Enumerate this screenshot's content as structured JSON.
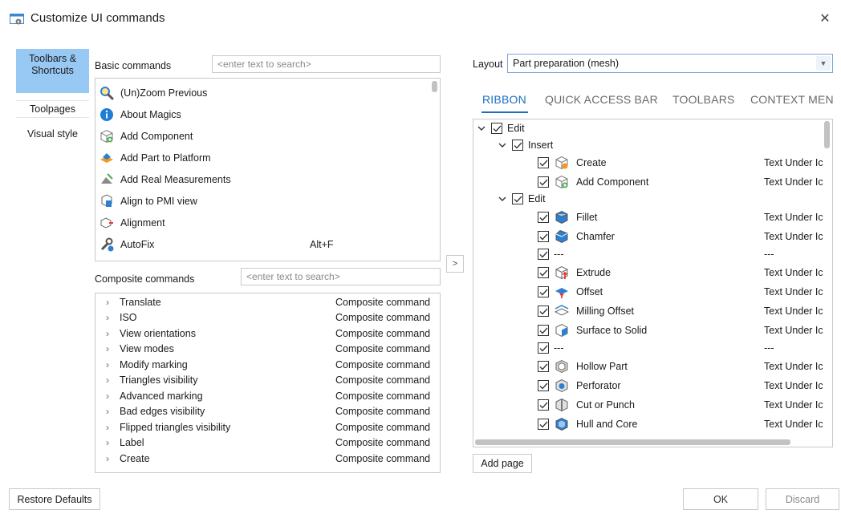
{
  "window": {
    "title": "Customize UI commands",
    "close_glyph": "✕"
  },
  "nav": [
    {
      "label": "Toolbars & Shortcuts"
    },
    {
      "label": "Toolpages"
    },
    {
      "label": "Visual style"
    }
  ],
  "basic": {
    "label": "Basic commands",
    "search_placeholder": "<enter text to search>",
    "items": [
      {
        "label": "(Un)Zoom Previous",
        "icon": "zoom-icon",
        "shortcut": ""
      },
      {
        "label": "About Magics",
        "icon": "info-icon",
        "shortcut": ""
      },
      {
        "label": "Add Component",
        "icon": "add-component-icon",
        "shortcut": ""
      },
      {
        "label": "Add Part to Platform",
        "icon": "add-part-icon",
        "shortcut": ""
      },
      {
        "label": "Add Real Measurements",
        "icon": "measurements-icon",
        "shortcut": ""
      },
      {
        "label": "Align to PMI view",
        "icon": "pmi-view-icon",
        "shortcut": ""
      },
      {
        "label": "Alignment",
        "icon": "alignment-icon",
        "shortcut": ""
      },
      {
        "label": "AutoFix",
        "icon": "autofix-icon",
        "shortcut": "Alt+F"
      }
    ]
  },
  "move_button": ">",
  "composite": {
    "label": "Composite commands",
    "search_placeholder": "<enter text to search>",
    "items": [
      {
        "label": "Translate",
        "value": "Composite command"
      },
      {
        "label": "ISO",
        "value": "Composite command"
      },
      {
        "label": "View orientations",
        "value": "Composite command"
      },
      {
        "label": "View modes",
        "value": "Composite command"
      },
      {
        "label": "Modify marking",
        "value": "Composite command"
      },
      {
        "label": "Triangles visibility",
        "value": "Composite command"
      },
      {
        "label": "Advanced marking",
        "value": "Composite command"
      },
      {
        "label": "Bad edges visibility",
        "value": "Composite command"
      },
      {
        "label": "Flipped triangles visibility",
        "value": "Composite command"
      },
      {
        "label": "Label",
        "value": "Composite command"
      },
      {
        "label": "Create",
        "value": "Composite command"
      }
    ]
  },
  "layout": {
    "label": "Layout",
    "value": "Part preparation (mesh)"
  },
  "tabs": [
    {
      "label": "RIBBON",
      "active": true
    },
    {
      "label": "QUICK ACCESS BAR",
      "active": false
    },
    {
      "label": "TOOLBARS",
      "active": false
    },
    {
      "label": "CONTEXT MEN",
      "active": false
    }
  ],
  "tree": [
    {
      "label": "Edit",
      "level": 0,
      "chevron": true,
      "icon": "",
      "display": ""
    },
    {
      "label": "Insert",
      "level": 1,
      "chevron": true,
      "icon": "",
      "display": ""
    },
    {
      "label": "Create",
      "level": 2,
      "chevron": false,
      "icon": "create-icon",
      "display": "Text Under Ic"
    },
    {
      "label": "Add Component",
      "level": 2,
      "chevron": false,
      "icon": "add-component-icon",
      "display": "Text Under Ic"
    },
    {
      "label": "Edit",
      "level": 1,
      "chevron": true,
      "icon": "",
      "display": ""
    },
    {
      "label": "Fillet",
      "level": 2,
      "chevron": false,
      "icon": "fillet-icon",
      "display": "Text Under Ic"
    },
    {
      "label": "Chamfer",
      "level": 2,
      "chevron": false,
      "icon": "chamfer-icon",
      "display": "Text Under Ic"
    },
    {
      "label": "---",
      "level": 2,
      "chevron": false,
      "icon": "",
      "display": "---"
    },
    {
      "label": "Extrude",
      "level": 2,
      "chevron": false,
      "icon": "extrude-icon",
      "display": "Text Under Ic"
    },
    {
      "label": "Offset",
      "level": 2,
      "chevron": false,
      "icon": "offset-icon",
      "display": "Text Under Ic"
    },
    {
      "label": "Milling Offset",
      "level": 2,
      "chevron": false,
      "icon": "milling-offset-icon",
      "display": "Text Under Ic"
    },
    {
      "label": "Surface to Solid",
      "level": 2,
      "chevron": false,
      "icon": "surface-to-solid-icon",
      "display": "Text Under Ic"
    },
    {
      "label": "---",
      "level": 2,
      "chevron": false,
      "icon": "",
      "display": "---"
    },
    {
      "label": "Hollow Part",
      "level": 2,
      "chevron": false,
      "icon": "hollow-part-icon",
      "display": "Text Under Ic"
    },
    {
      "label": "Perforator",
      "level": 2,
      "chevron": false,
      "icon": "perforator-icon",
      "display": "Text Under Ic"
    },
    {
      "label": "Cut or Punch",
      "level": 2,
      "chevron": false,
      "icon": "cut-or-punch-icon",
      "display": "Text Under Ic"
    },
    {
      "label": "Hull and Core",
      "level": 2,
      "chevron": false,
      "icon": "hull-and-core-icon",
      "display": "Text Under Ic"
    }
  ],
  "buttons": {
    "add_page": "Add page",
    "restore_defaults": "Restore Defaults",
    "ok": "OK",
    "discard": "Discard"
  },
  "colors": {
    "accent": "#1a6fc4",
    "nav_selected": "#98c8f4",
    "icon_blue": "#2d7fd1",
    "icon_orange": "#f39a1e"
  }
}
